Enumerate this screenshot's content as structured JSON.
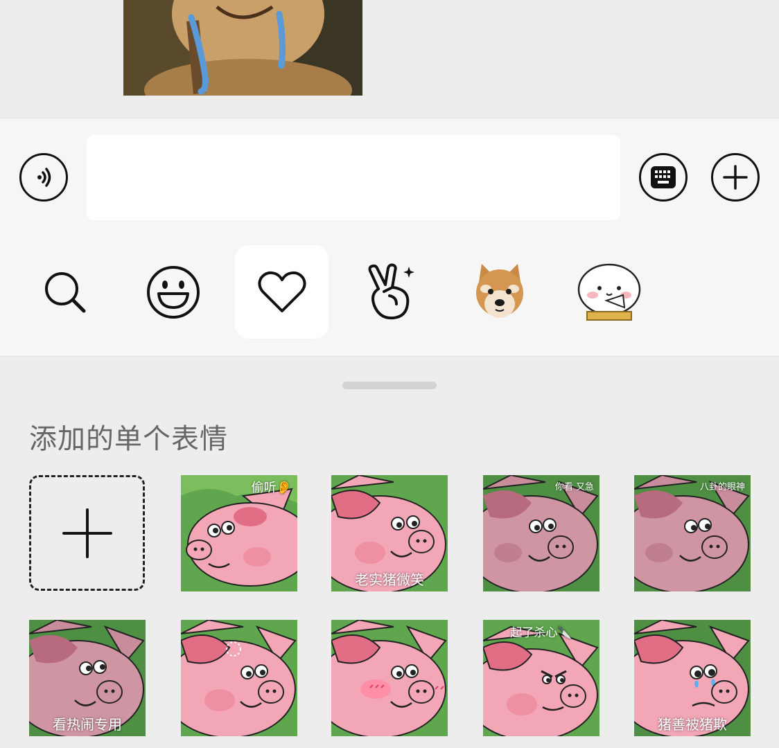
{
  "chat": {
    "sent_image_alt": ""
  },
  "input_bar": {
    "message_value": "",
    "message_placeholder": ""
  },
  "tabs": [
    {
      "name": "search",
      "icon": "search-icon"
    },
    {
      "name": "emoji",
      "icon": "smiley-icon"
    },
    {
      "name": "favorites",
      "icon": "heart-icon",
      "active": true
    },
    {
      "name": "gesture",
      "icon": "victory-hand-icon"
    },
    {
      "name": "doge",
      "icon": "shiba-sticker-icon"
    },
    {
      "name": "bun",
      "icon": "bun-sticker-icon"
    }
  ],
  "panel": {
    "section_title": "添加的单个表情",
    "stickers": [
      {
        "caption": "偷听👂"
      },
      {
        "caption": "老实猪微笑"
      },
      {
        "caption": "你看 又急"
      },
      {
        "caption": "八卦的眼神"
      },
      {
        "caption": "看热闹专用"
      },
      {
        "caption": ""
      },
      {
        "caption": ""
      },
      {
        "caption": "起了杀心🔪"
      },
      {
        "caption": "猪善被猪欺"
      }
    ]
  },
  "colors": {
    "background": "#ededed",
    "input_bar": "#f6f6f6",
    "pig_pink": "#f2a6b6",
    "grass_green": "#5a9a4a"
  }
}
